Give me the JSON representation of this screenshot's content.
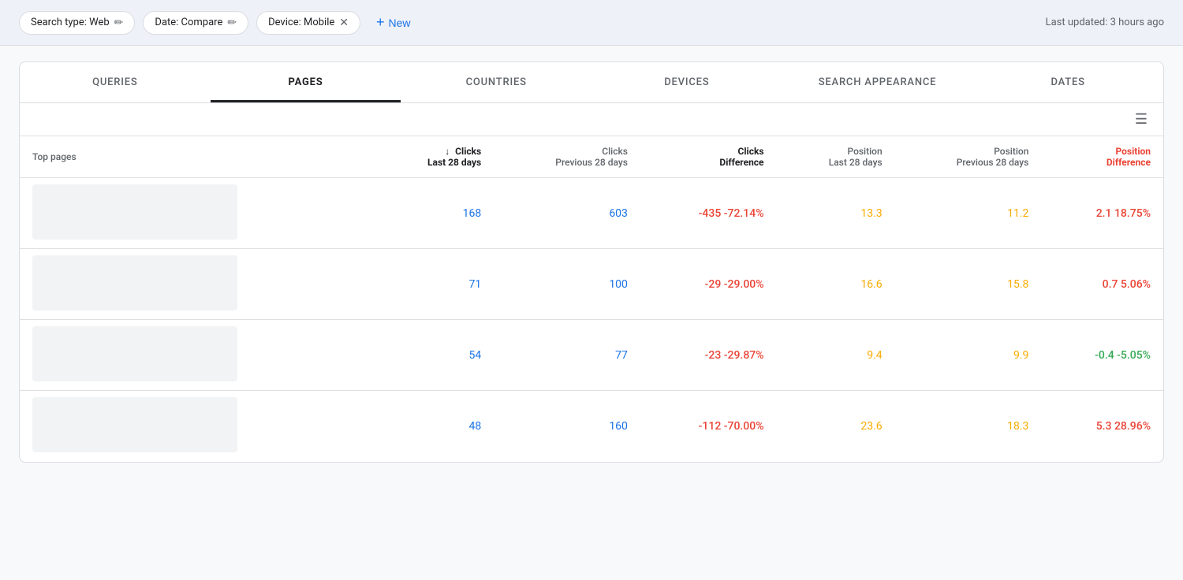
{
  "topbar": {
    "filters": [
      {
        "id": "search-type",
        "label": "Search type: Web",
        "hasEdit": true,
        "hasClose": false
      },
      {
        "id": "date",
        "label": "Date: Compare",
        "hasEdit": true,
        "hasClose": false
      },
      {
        "id": "device",
        "label": "Device: Mobile",
        "hasEdit": false,
        "hasClose": true
      }
    ],
    "new_button_label": "New",
    "last_updated": "Last updated: 3 hours ago"
  },
  "tabs": [
    {
      "id": "queries",
      "label": "QUERIES",
      "active": false
    },
    {
      "id": "pages",
      "label": "PAGES",
      "active": true
    },
    {
      "id": "countries",
      "label": "COUNTRIES",
      "active": false
    },
    {
      "id": "devices",
      "label": "DEVICES",
      "active": false
    },
    {
      "id": "search-appearance",
      "label": "SEARCH APPEARANCE",
      "active": false
    },
    {
      "id": "dates",
      "label": "DATES",
      "active": false
    }
  ],
  "table": {
    "columns": {
      "top_pages": "Top pages",
      "clicks_last": {
        "line1": "Clicks",
        "line2": "Last 28 days"
      },
      "clicks_prev": {
        "line1": "Clicks",
        "line2": "Previous 28 days"
      },
      "clicks_diff": {
        "line1": "Clicks",
        "line2": "Difference"
      },
      "pos_last": {
        "line1": "Position",
        "line2": "Last 28 days"
      },
      "pos_prev": {
        "line1": "Position",
        "line2": "Previous 28 days"
      },
      "pos_diff": {
        "line1": "Position",
        "line2": "Difference"
      }
    },
    "rows": [
      {
        "clicks_last": "168",
        "clicks_prev": "603",
        "clicks_diff": "-435 -72.14%",
        "clicks_diff_type": "negative",
        "pos_last": "13.3",
        "pos_prev": "11.2",
        "pos_diff": "2.1 18.75%",
        "pos_diff_type": "negative"
      },
      {
        "clicks_last": "71",
        "clicks_prev": "100",
        "clicks_diff": "-29 -29.00%",
        "clicks_diff_type": "negative",
        "pos_last": "16.6",
        "pos_prev": "15.8",
        "pos_diff": "0.7 5.06%",
        "pos_diff_type": "negative"
      },
      {
        "clicks_last": "54",
        "clicks_prev": "77",
        "clicks_diff": "-23 -29.87%",
        "clicks_diff_type": "negative",
        "pos_last": "9.4",
        "pos_prev": "9.9",
        "pos_diff": "-0.4 -5.05%",
        "pos_diff_type": "positive"
      },
      {
        "clicks_last": "48",
        "clicks_prev": "160",
        "clicks_diff": "-112 -70.00%",
        "clicks_diff_type": "negative",
        "pos_last": "23.6",
        "pos_prev": "18.3",
        "pos_diff": "5.3 28.96%",
        "pos_diff_type": "negative"
      }
    ]
  }
}
